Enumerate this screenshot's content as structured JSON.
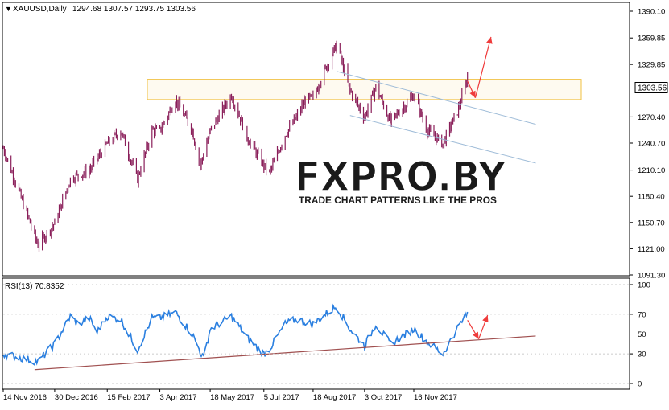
{
  "header": {
    "symbol": "XAUUSD,Daily",
    "ohlc": "1294.68 1307.57 1293.75 1303.56",
    "current_price": "1303.56"
  },
  "indicator": {
    "label": "RSI(13) 70.8352"
  },
  "watermark": {
    "logo_text": "FXPRO.BY",
    "tagline": "TRADE CHART PATTERNS LIKE THE PROS"
  },
  "colors": {
    "background": "#ffffff",
    "candle": "#8a1f5a",
    "rsi_line": "#2a7fe0",
    "trendline": "#a05050",
    "channel": "#9fbcd8",
    "resistance_zone": "#f0c040",
    "arrow": "#ef3b3b",
    "axis": "#000000",
    "price_tag_bg": "#ffffff"
  },
  "chart_data": [
    {
      "type": "candlestick",
      "title": "XAUUSD,Daily",
      "ylim": [
        1091.3,
        1390.1
      ],
      "y_ticks": [
        "1390.10",
        "1359.85",
        "1329.85",
        "1303.56",
        "1270.40",
        "1240.70",
        "1210.10",
        "1180.40",
        "1150.70",
        "1121.00",
        "1091.30"
      ],
      "x_ticks": [
        "14 Nov 2016",
        "30 Dec 2016",
        "15 Feb 2017",
        "3 Apr 2017",
        "18 May 2017",
        "5 Jul 2017",
        "18 Aug 2017",
        "3 Oct 2017",
        "16 Nov 2017"
      ],
      "anchors": [
        [
          "14 Nov 2016",
          1235
        ],
        [
          "24 Nov 2016",
          1200
        ],
        [
          "15 Dec 2016",
          1125
        ],
        [
          "30 Dec 2016",
          1150
        ],
        [
          "13 Jan 2017",
          1200
        ],
        [
          "30 Jan 2017",
          1210
        ],
        [
          "15 Feb 2017",
          1240
        ],
        [
          "27 Feb 2017",
          1255
        ],
        [
          "14 Mar 2017",
          1200
        ],
        [
          "27 Mar 2017",
          1255
        ],
        [
          "3 Apr 2017",
          1255
        ],
        [
          "17 Apr 2017",
          1290
        ],
        [
          "2 May 2017",
          1255
        ],
        [
          "9 May 2017",
          1215
        ],
        [
          "18 May 2017",
          1255
        ],
        [
          "6 Jun 2017",
          1295
        ],
        [
          "21 Jun 2017",
          1245
        ],
        [
          "5 Jul 2017",
          1215
        ],
        [
          "10 Jul 2017",
          1207
        ],
        [
          "24 Jul 2017",
          1250
        ],
        [
          "3 Aug 2017",
          1270
        ],
        [
          "11 Aug 2017",
          1290
        ],
        [
          "18 Aug 2017",
          1292
        ],
        [
          "29 Aug 2017",
          1325
        ],
        [
          "8 Sep 2017",
          1352
        ],
        [
          "20 Sep 2017",
          1300
        ],
        [
          "3 Oct 2017",
          1270
        ],
        [
          "13 Oct 2017",
          1305
        ],
        [
          "26 Oct 2017",
          1265
        ],
        [
          "16 Nov 2017",
          1295
        ],
        [
          "28 Nov 2017",
          1255
        ],
        [
          "12 Dec 2017",
          1240
        ],
        [
          "26 Dec 2017",
          1280
        ],
        [
          "3 Jan 2018",
          1315
        ]
      ],
      "current": 1303.56,
      "resistance_zone": [
        1290,
        1313
      ],
      "channel": [
        {
          "from": [
            "8 Sep 2017",
            1322
          ],
          "to": [
            "5 Mar 2018",
            1262
          ]
        },
        {
          "from": [
            "20 Sep 2017",
            1272
          ],
          "to": [
            "5 Mar 2018",
            1218
          ]
        }
      ],
      "forecast_arrows": [
        {
          "from": [
            "3 Jan 2018",
            1311
          ],
          "to": [
            "10 Jan 2018",
            1292
          ]
        },
        {
          "from": [
            "10 Jan 2018",
            1292
          ],
          "to": [
            "24 Jan 2018",
            1361
          ]
        }
      ]
    },
    {
      "type": "line",
      "title": "RSI(13) 70.8352",
      "ylim": [
        0,
        100
      ],
      "y_ticks": [
        "100",
        "70",
        "50",
        "30",
        "0"
      ],
      "anchors": [
        [
          "14 Nov 2016",
          30
        ],
        [
          "15 Dec 2016",
          22
        ],
        [
          "30 Dec 2016",
          40
        ],
        [
          "13 Jan 2017",
          68
        ],
        [
          "20 Jan 2017",
          60
        ],
        [
          "30 Jan 2017",
          66
        ],
        [
          "6 Feb 2017",
          52
        ],
        [
          "15 Feb 2017",
          68
        ],
        [
          "27 Feb 2017",
          65
        ],
        [
          "14 Mar 2017",
          34
        ],
        [
          "27 Mar 2017",
          66
        ],
        [
          "3 Apr 2017",
          66
        ],
        [
          "17 Apr 2017",
          72
        ],
        [
          "2 May 2017",
          50
        ],
        [
          "12 May 2017",
          25
        ],
        [
          "18 May 2017",
          55
        ],
        [
          "6 Jun 2017",
          68
        ],
        [
          "21 Jun 2017",
          45
        ],
        [
          "5 Jul 2017",
          30
        ],
        [
          "10 Jul 2017",
          35
        ],
        [
          "24 Jul 2017",
          60
        ],
        [
          "3 Aug 2017",
          65
        ],
        [
          "18 Aug 2017",
          60
        ],
        [
          "29 Aug 2017",
          70
        ],
        [
          "8 Sep 2017",
          78
        ],
        [
          "20 Sep 2017",
          55
        ],
        [
          "3 Oct 2017",
          38
        ],
        [
          "13 Oct 2017",
          60
        ],
        [
          "26 Oct 2017",
          40
        ],
        [
          "16 Nov 2017",
          55
        ],
        [
          "28 Nov 2017",
          42
        ],
        [
          "12 Dec 2017",
          30
        ],
        [
          "26 Dec 2017",
          58
        ],
        [
          "3 Jan 2018",
          70.8
        ]
      ],
      "trendline": {
        "from": [
          "12 Dec 2016",
          14
        ],
        "to": [
          "5 Mar 2018",
          48
        ]
      },
      "forecast_arrows": [
        {
          "from": [
            "3 Jan 2018",
            64
          ],
          "to": [
            "13 Jan 2018",
            45
          ]
        },
        {
          "from": [
            "13 Jan 2018",
            45
          ],
          "to": [
            "21 Jan 2018",
            69
          ]
        }
      ]
    }
  ]
}
